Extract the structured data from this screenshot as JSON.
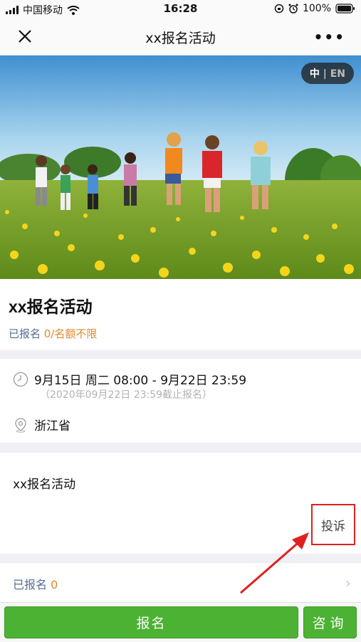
{
  "status_bar": {
    "carrier": "中国移动",
    "time": "16:28",
    "battery": "100%"
  },
  "nav": {
    "title": "xx报名活动",
    "more": "•••"
  },
  "banner": {
    "lang_cn": "中",
    "lang_sep": "|",
    "lang_en": "EN"
  },
  "activity": {
    "title": "xx报名活动",
    "registered_prefix": "已报名",
    "registered_count": "0",
    "quota": "/名额不限"
  },
  "info": {
    "datetime": "9月15日 周二 08:00 - 9月22日 23:59",
    "deadline": "（2020年09月22日 23:59截止报名）",
    "location": "浙江省"
  },
  "description": {
    "text": "xx报名活动",
    "complain": "投诉"
  },
  "registered_list": {
    "label": "已报名",
    "count": "0"
  },
  "actions": {
    "signup": "报名",
    "consult": "咨询"
  }
}
